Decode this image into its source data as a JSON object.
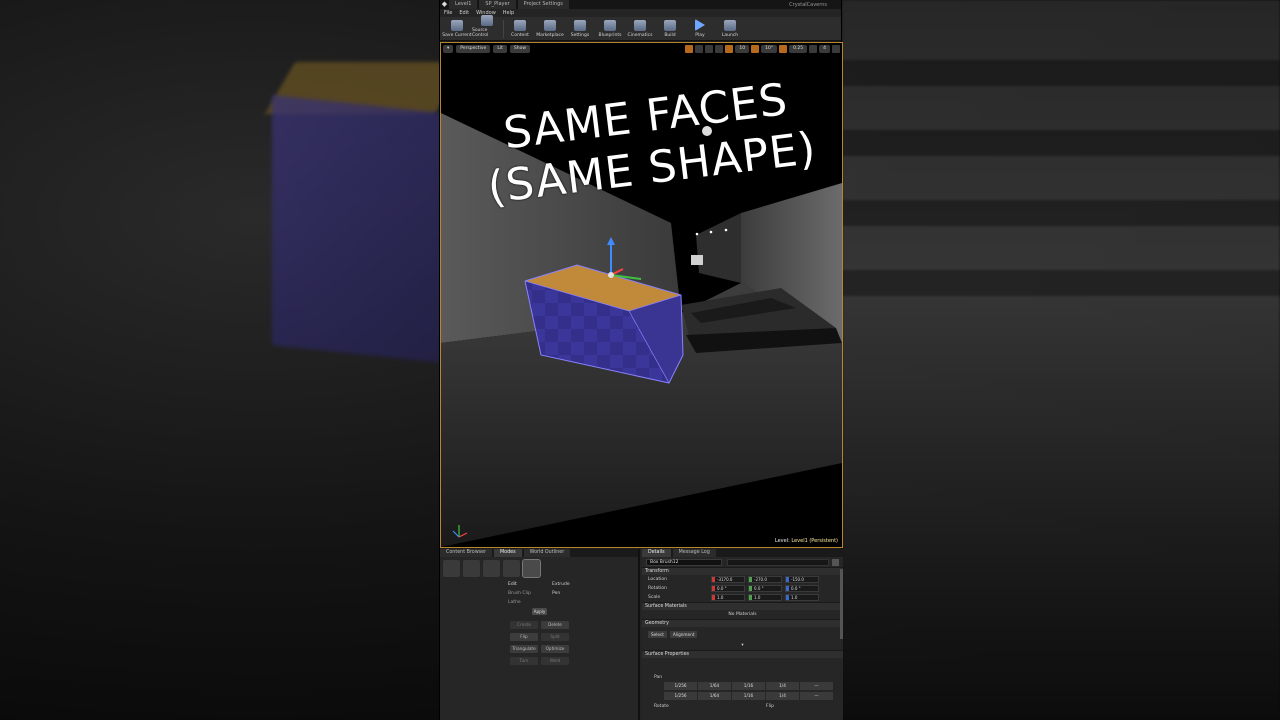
{
  "window": {
    "tabs": [
      "Level1",
      "SP_Player",
      "Project Settings"
    ],
    "project_name": "CrystalCaverns"
  },
  "menu": [
    "File",
    "Edit",
    "Window",
    "Help"
  ],
  "toolbar": [
    {
      "label": "Save Current",
      "icon": "save-icon"
    },
    {
      "label": "Source Control",
      "icon": "source-control-icon"
    },
    {
      "label": "Content",
      "icon": "content-icon"
    },
    {
      "label": "Marketplace",
      "icon": "marketplace-icon"
    },
    {
      "label": "Settings",
      "icon": "gear-icon"
    },
    {
      "label": "Blueprints",
      "icon": "blueprint-icon"
    },
    {
      "label": "Cinematics",
      "icon": "clapper-icon"
    },
    {
      "label": "Build",
      "icon": "build-icon"
    },
    {
      "label": "Play",
      "icon": "play-icon"
    },
    {
      "label": "Launch",
      "icon": "launch-icon"
    }
  ],
  "viewport": {
    "perspective_label": "Perspective",
    "lit_label": "Lit",
    "show_label": "Show",
    "grid_value": "10",
    "angle_value": "10°",
    "scale_value": "0.25",
    "camera_speed": "4",
    "caption_line1": "SAME FACES",
    "caption_line2": "(SAME SHAPE)",
    "level_label": "Level: ",
    "level_name": "Level1 (Persistent)"
  },
  "left_panel": {
    "tabs": [
      "Content Browser",
      "Modes",
      "World Outliner"
    ],
    "options": {
      "edit": "Edit",
      "extrude": "Extrude",
      "brush_clip": "Brush Clip",
      "pen": "Pen",
      "lathe": "Lathe",
      "apply": "Apply"
    },
    "geometry_buttons": [
      "Create",
      "Delete",
      "Flip",
      "Split",
      "Triangulate",
      "Optimize",
      "Turn",
      "Weld"
    ]
  },
  "right_panel": {
    "tabs": [
      "Details",
      "Message Log"
    ],
    "object_name": "Box Brush12",
    "transform_header": "Transform",
    "location_label": "Location",
    "rotation_label": "Rotation",
    "scale_label": "Scale",
    "location": [
      "-3170.0",
      "-270.0",
      "-150.0"
    ],
    "rotation": [
      "0.0 °",
      "0.0 °",
      "0.0 °"
    ],
    "scale": [
      "1.0",
      "1.0",
      "1.0"
    ],
    "surface_materials_header": "Surface Materials",
    "no_materials": "No Materials",
    "geometry_header": "Geometry",
    "select_label": "Select",
    "alignment_label": "Alignment",
    "surface_properties_header": "Surface Properties",
    "pan_label": "Pan",
    "pan_values": [
      "1/256",
      "1/64",
      "1/16",
      "1/4"
    ],
    "rotate_label": "Rotate",
    "flip_label": "Flip"
  }
}
